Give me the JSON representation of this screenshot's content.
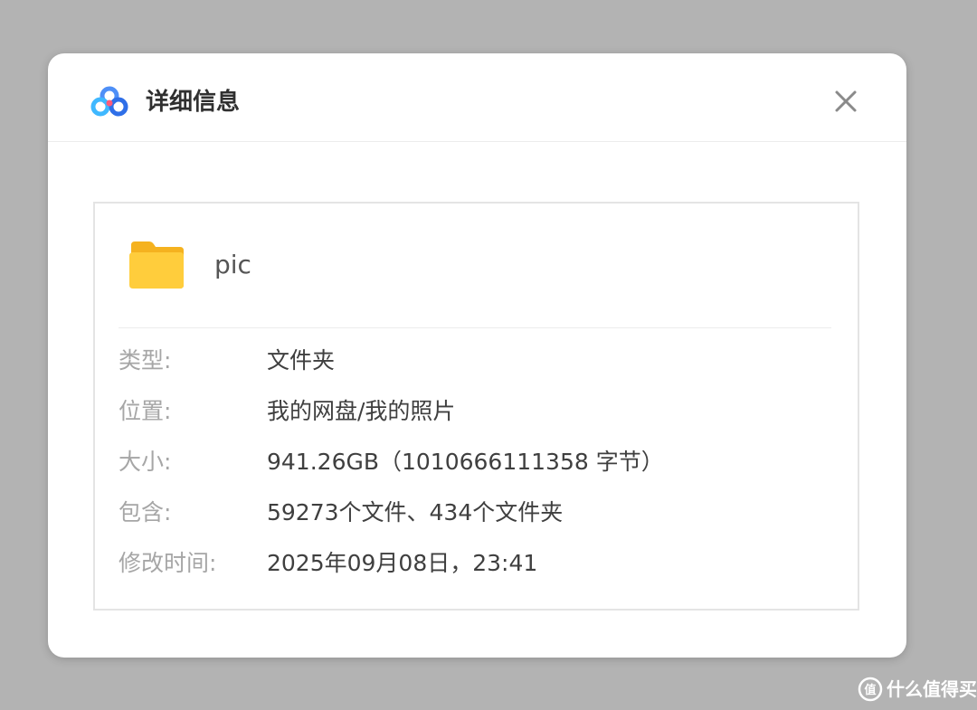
{
  "dialog": {
    "title": "详细信息",
    "logo_icon": "baidu-netdisk-logo-icon",
    "close_icon": "close-icon"
  },
  "file": {
    "icon": "folder-icon",
    "name": "pic"
  },
  "details": [
    {
      "label": "类型:",
      "value": "文件夹"
    },
    {
      "label": "位置:",
      "value": "我的网盘/我的照片"
    },
    {
      "label": "大小:",
      "value": "941.26GB（1010666111358 字节）"
    },
    {
      "label": "包含:",
      "value": "59273个文件、434个文件夹"
    },
    {
      "label": "修改时间:",
      "value": "2025年09月08日，23:41"
    }
  ],
  "watermark": {
    "icon": "smzdm-logo-icon",
    "text": "什么值得买"
  },
  "colors": {
    "background": "#b3b3b3",
    "folder_yellow": "#ffc83d",
    "label_gray": "#a6a6a6",
    "value_dark": "#3f3f3f"
  }
}
